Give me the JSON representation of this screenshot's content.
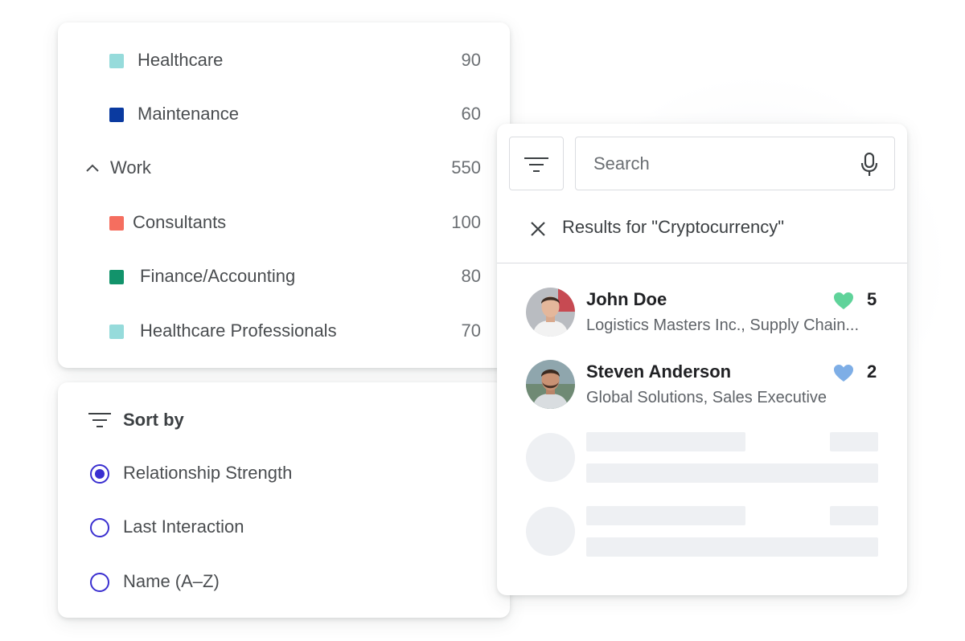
{
  "categories": [
    {
      "label": "Healthcare",
      "count": "90",
      "color": "#96dbdb",
      "type": "item"
    },
    {
      "label": "Maintenance",
      "count": "60",
      "color": "#0a3aa0",
      "type": "item"
    },
    {
      "label": "Work",
      "count": "550",
      "type": "group",
      "expanded": true
    },
    {
      "label": "Consultants",
      "count": "100",
      "color": "#f56e5f",
      "type": "item"
    },
    {
      "label": "Finance/Accounting",
      "count": "80",
      "color": "#12936b",
      "type": "item"
    },
    {
      "label": "Healthcare Professionals",
      "count": "70",
      "color": "#96dbdb",
      "type": "item"
    }
  ],
  "sort": {
    "title": "Sort by",
    "options": [
      {
        "label": "Relationship Strength",
        "checked": true
      },
      {
        "label": "Last Interaction",
        "checked": false
      },
      {
        "label": "Name (A–Z)",
        "checked": false
      }
    ],
    "accent": "#3a2fd0"
  },
  "search": {
    "placeholder": "Search",
    "results_label": "Results for \"Cryptocurrency\"",
    "results": [
      {
        "name": "John Doe",
        "subtitle": "Logistics Masters Inc., Supply Chain...",
        "score": "5",
        "heart_color": "#5fd39a",
        "avatar": "john-doe-avatar"
      },
      {
        "name": "Steven Anderson",
        "subtitle": "Global Solutions, Sales Executive",
        "score": "2",
        "heart_color": "#7eaee6",
        "avatar": "steven-anderson-avatar"
      }
    ],
    "skeleton_rows": 2
  }
}
